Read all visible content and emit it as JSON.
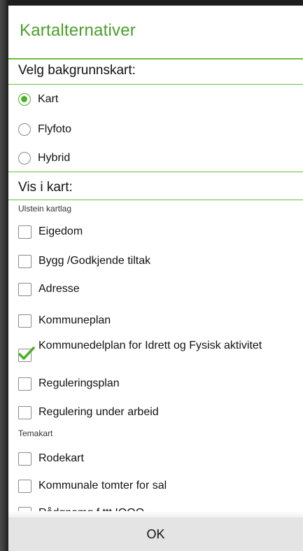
{
  "dialog": {
    "title": "Kartalternativer",
    "ok_label": "OK"
  },
  "background_section": {
    "header": "Velg bakgrunnskart:",
    "options": [
      {
        "label": "Kart",
        "selected": true
      },
      {
        "label": "Flyfoto",
        "selected": false
      },
      {
        "label": "Hybrid",
        "selected": false
      }
    ]
  },
  "layers_section": {
    "header": "Vis i kart:",
    "groups": [
      {
        "header": "Ulstein kartlag",
        "items": [
          {
            "label": "Eigedom",
            "checked": false
          },
          {
            "label": "Bygg /Godkjende tiltak",
            "checked": false
          },
          {
            "label": "Adresse",
            "checked": false
          },
          {
            "label": "Kommuneplan",
            "checked": false
          },
          {
            "label": "Kommunedelplan for Idrett og Fysisk aktivitet",
            "checked": true
          },
          {
            "label": "Reguleringsplan",
            "checked": false
          },
          {
            "label": "Regulering under arbeid",
            "checked": false
          }
        ]
      },
      {
        "header": "Temakart",
        "items": [
          {
            "label": "Rodekart",
            "checked": false
          },
          {
            "label": "Kommunale tomter for sal",
            "checked": false
          },
          {
            "label": "Rådgnomg f     ttt IOOO",
            "checked": false
          }
        ]
      }
    ]
  },
  "colors": {
    "accent": "#4caf27",
    "title": "#4a9e2b",
    "divider": "#6abf3a"
  }
}
